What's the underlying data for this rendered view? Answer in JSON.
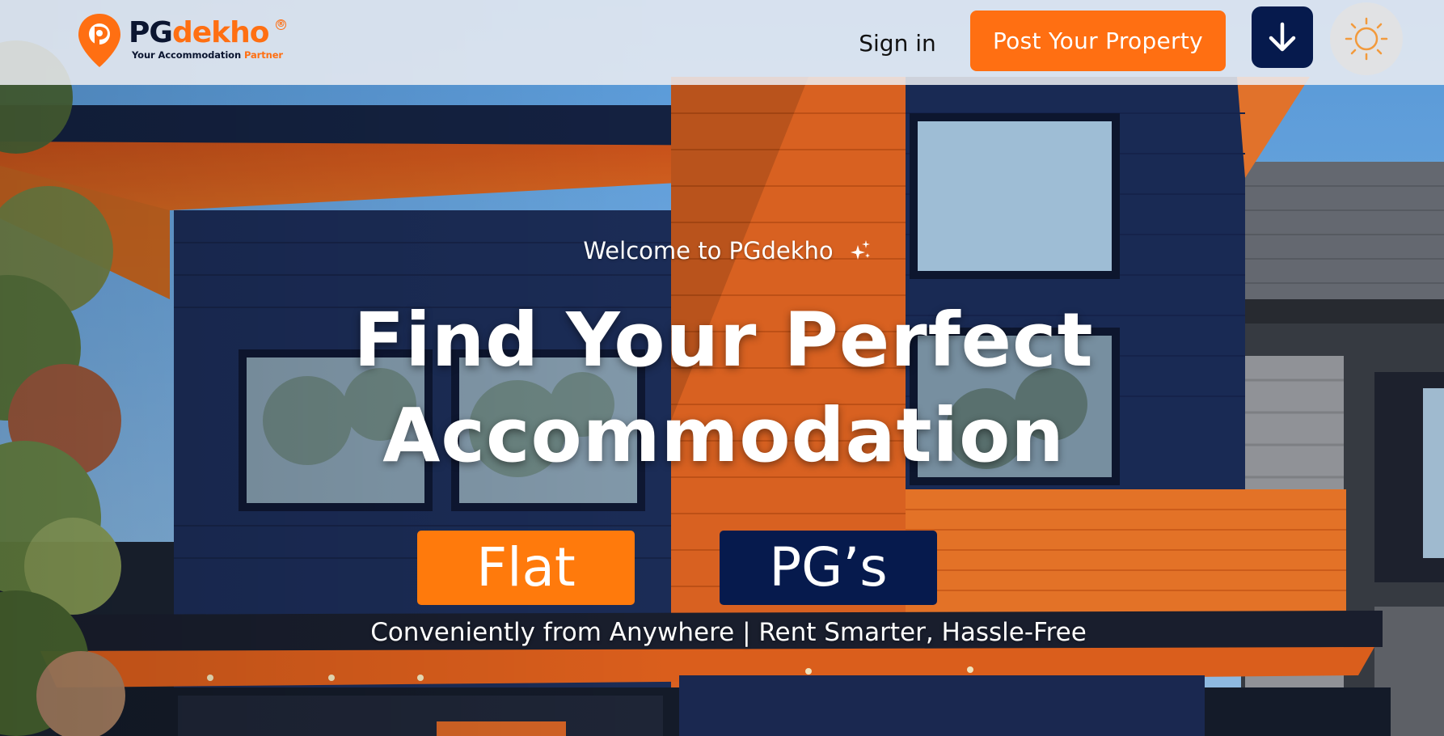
{
  "header": {
    "logo": {
      "name_part1": "PG",
      "name_part2": "dekho",
      "registered": "®",
      "tagline_part1": "Your Accommodation ",
      "tagline_part2": "Partner"
    },
    "signin_label": "Sign in",
    "post_property_label": "Post Your Property",
    "download_icon": "arrow-down-icon",
    "theme_icon": "sun-icon"
  },
  "hero": {
    "welcome_text": "Welcome to PGdekho",
    "welcome_icon": "sparkle-icon",
    "headline_line1": "Find Your Perfect",
    "headline_line2": "Accommodation",
    "options": [
      {
        "label": "Flat"
      },
      {
        "label": "PG’s"
      }
    ],
    "tagline": "Conveniently from Anywhere | Rent Smarter, Hassle-Free"
  },
  "colors": {
    "brand_orange": "#ff6f12",
    "brand_navy": "#061a4d",
    "header_bg": "#eceef2"
  }
}
